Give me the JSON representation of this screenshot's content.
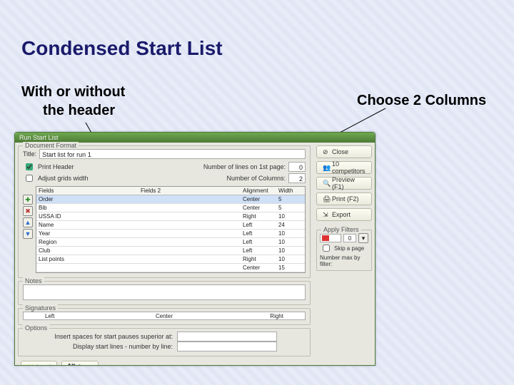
{
  "slide": {
    "title": "Condensed Start List",
    "annot_left_line1": "With or without",
    "annot_left_line2": "the header",
    "annot_right": "Choose 2 Columns"
  },
  "dialog": {
    "title": "Run Start List",
    "group_docformat": "Document Format",
    "title_label": "Title:",
    "title_value": "Start list for run 1",
    "print_header_label": "Print Header",
    "print_header_checked": true,
    "adjust_grids_label": "Adjust grids width",
    "adjust_grids_checked": false,
    "lines_1st_label": "Number of lines on 1st page:",
    "lines_1st_value": "0",
    "cols_label": "Number of Columns:",
    "cols_value": "2",
    "grid_headers": {
      "fields": "Fields",
      "fields2": "Fields 2",
      "alignment": "Alignment",
      "width": "Width"
    },
    "grid_rows": [
      {
        "fields": "Order",
        "fields2": "",
        "alignment": "Center",
        "width": "5",
        "sel": true
      },
      {
        "fields": "Bib",
        "fields2": "",
        "alignment": "Center",
        "width": "5",
        "sel": false
      },
      {
        "fields": "USSA ID",
        "fields2": "",
        "alignment": "Right",
        "width": "10",
        "sel": false
      },
      {
        "fields": "Name",
        "fields2": "",
        "alignment": "Left",
        "width": "24",
        "sel": false
      },
      {
        "fields": "Year",
        "fields2": "",
        "alignment": "Left",
        "width": "10",
        "sel": false
      },
      {
        "fields": "Region",
        "fields2": "",
        "alignment": "Left",
        "width": "10",
        "sel": false
      },
      {
        "fields": "Club",
        "fields2": "",
        "alignment": "Left",
        "width": "10",
        "sel": false
      },
      {
        "fields": "List points",
        "fields2": "",
        "alignment": "Right",
        "width": "10",
        "sel": false
      },
      {
        "fields": "",
        "fields2": "",
        "alignment": "Center",
        "width": "15",
        "sel": false
      }
    ],
    "notes_label": "Notes",
    "signatures_label": "Signatures",
    "sig_left": "Left",
    "sig_center": "Center",
    "sig_right": "Right",
    "options_label": "Options",
    "opt_spaces_label": "Insert spaces for start pauses superior at:",
    "opt_display_label": "Display start lines - number by line:",
    "btn_load": "Load",
    "btn_save": "Save",
    "btn_close": "Close",
    "btn_competitors": "10 competitors",
    "btn_preview": "Preview (F1)",
    "btn_print": "Print (F2)",
    "btn_export": "Export",
    "filters_label": "Apply Filters",
    "filters_count": "0",
    "skip_label": "Skip a page",
    "skip_checked": false,
    "num_by_filter": "Number max by filter:"
  }
}
